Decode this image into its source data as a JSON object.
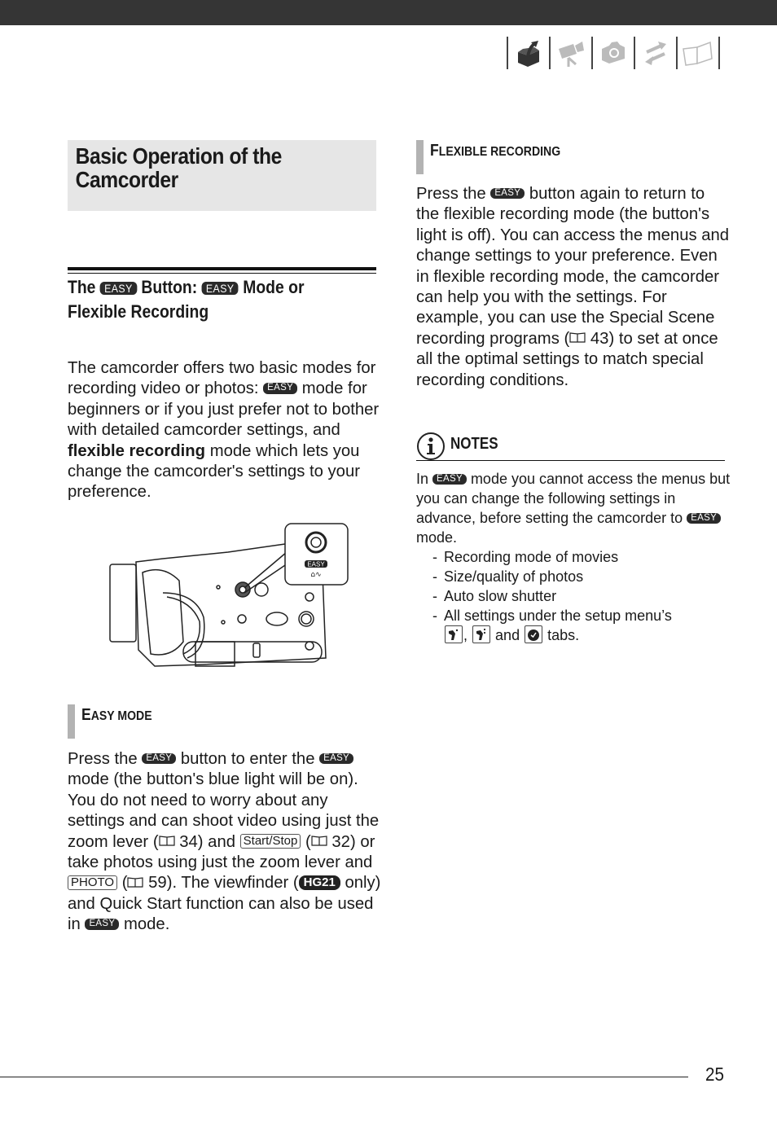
{
  "header": {
    "tabs": [
      {
        "name": "preparations-tab",
        "icon": "box-arrow-icon",
        "active": true
      },
      {
        "name": "video-tab",
        "icon": "video-camera-icon",
        "active": false
      },
      {
        "name": "photos-tab",
        "icon": "camera-icon",
        "active": false
      },
      {
        "name": "external-connections-tab",
        "icon": "arrows-icon",
        "active": false
      },
      {
        "name": "additional-info-tab",
        "icon": "book-icon",
        "active": false
      }
    ]
  },
  "title": "Basic Operation of the Camcorder",
  "subheading": {
    "part1": "The",
    "badge": "EASY",
    "part2": "Button:",
    "part3": "Mode or",
    "part4": "Flexible Recording"
  },
  "intro": {
    "t1": "The camcorder offers two basic modes for recording video or photos:",
    "badge": "EASY",
    "t2": "mode for beginners or if you just prefer not to bother with detailed camcorder settings, and",
    "bold": "flexible recording",
    "t3": "mode which lets you change the camcorder's settings to your preference."
  },
  "illustration": {
    "callout_badge": "EASY",
    "alt": "Camcorder side view with EASY button highlighted"
  },
  "easy_mode": {
    "heading_first": "E",
    "heading_rest": "ASY MODE",
    "t1": "Press the",
    "badge": "EASY",
    "t2": "button to enter the",
    "t3": "mode (the button's blue light will be on). You do not need to worry about any settings and can shoot video using just the zoom lever (",
    "ref1": "34",
    "t4": ") and",
    "key_start": "Start/Stop",
    "t5": "(",
    "ref2": "32",
    "t6": ") or take photos using just the zoom lever and",
    "key_photo": "PHOTO",
    "t7": "(",
    "ref3": "59",
    "t8": "). The viewfinder (",
    "model_badge": "HG21",
    "t9": "only) and Quick Start function can also be used in",
    "t10": "mode."
  },
  "flexible": {
    "heading_first": "F",
    "heading_rest": "LEXIBLE RECORDING",
    "t1": "Press the",
    "badge": "EASY",
    "t2": "button again to return to the flexible recording mode (the button's light is off). You can access the menus and change settings to your preference. Even in flexible recording mode, the camcorder can help you with the settings. For example, you can use the Special Scene recording programs (",
    "ref": "43",
    "t3": ") to set at once all the optimal settings to match special recording conditions."
  },
  "notes": {
    "label": "NOTES",
    "t1": "In",
    "badge": "EASY",
    "t2": "mode you cannot access the menus but you can change the following settings in advance, before setting the camcorder to",
    "t3": "mode.",
    "items": [
      "Recording mode of movies",
      "Size/quality of photos",
      "Auto slow shutter",
      "All settings under the setup menu’s"
    ],
    "tabs_sep1": ",",
    "tabs_and": "and",
    "tabs_end": "tabs."
  },
  "footer": {
    "page_number": "25"
  }
}
